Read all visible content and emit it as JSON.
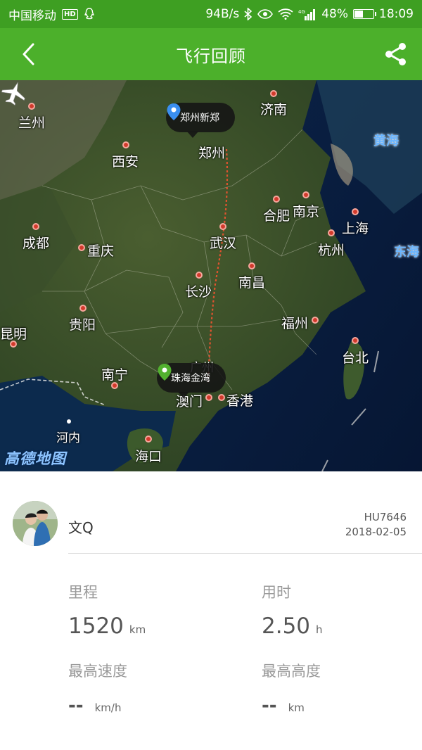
{
  "status_bar": {
    "carrier": "中国移动",
    "hd_badge": "HD",
    "net_speed": "94B/s",
    "network_type": "4G",
    "battery_percent": "48%",
    "battery_level": 0.48,
    "time": "18:09"
  },
  "header": {
    "title": "飞行回顾",
    "back_icon": "chevron-left-icon",
    "share_icon": "share-icon",
    "background_color": "#4cb02b"
  },
  "map": {
    "cities": {
      "lanzhou": "兰州",
      "jinan": "济南",
      "xian": "西安",
      "zhengzhou": "郑州",
      "hefei": "合肥",
      "nanjing": "南京",
      "shanghai": "上海",
      "chengdu": "成都",
      "chongqing": "重庆",
      "wuhan": "武汉",
      "hangzhou": "杭州",
      "changsha": "长沙",
      "nanchang": "南昌",
      "kunming": "昆明",
      "guiyang": "贵阳",
      "fuzhou": "福州",
      "taipei": "台北",
      "nanning": "南宁",
      "guangzhou": "广州",
      "macau": "澳门",
      "hongkong": "香港",
      "hanoi": "河内",
      "haikou": "海口"
    },
    "seas": {
      "yellow_sea": "黄海",
      "east_sea": "东海"
    },
    "departure": "郑州新郑",
    "arrival": "珠海金湾",
    "logo": "高德地图",
    "route_color": "#e0532f"
  },
  "flight": {
    "user_name": "文Q",
    "flight_number": "HU7646",
    "date": "2018-02-05",
    "distance_label": "里程",
    "distance_value": "1520",
    "distance_unit": "km",
    "duration_label": "用时",
    "duration_value": "2.50",
    "duration_unit": "h",
    "max_speed_label": "最高速度",
    "max_speed_value": "--",
    "max_speed_unit": "km/h",
    "max_altitude_label": "最高高度",
    "max_altitude_value": "--",
    "max_altitude_unit": "km"
  }
}
